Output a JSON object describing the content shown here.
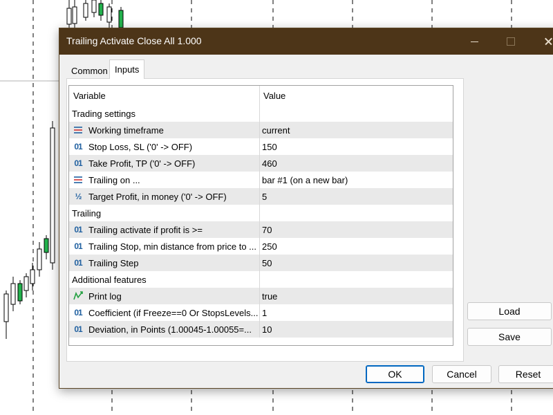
{
  "dialog": {
    "title": "Trailing Activate Close All 1.000"
  },
  "tabs": [
    {
      "label": "Common",
      "active": false
    },
    {
      "label": "Inputs",
      "active": true
    }
  ],
  "grid": {
    "headers": {
      "variable": "Variable",
      "value": "Value"
    },
    "rows": [
      {
        "type": "group",
        "variable": "Trading settings",
        "value": ""
      },
      {
        "type": "param",
        "icon": "enum-icon",
        "variable": "Working timeframe",
        "value": "current"
      },
      {
        "type": "param",
        "icon": "integer-icon",
        "variable": "Stop Loss, SL ('0' -> OFF)",
        "value": "150"
      },
      {
        "type": "param",
        "icon": "integer-icon",
        "variable": "Take Profit, TP ('0' -> OFF)",
        "value": "460"
      },
      {
        "type": "param",
        "icon": "enum-icon",
        "variable": "Trailing on ...",
        "value": "bar #1 (on a new bar)"
      },
      {
        "type": "param",
        "icon": "fraction-icon",
        "variable": "Target Profit, in money ('0' -> OFF)",
        "value": "5"
      },
      {
        "type": "group",
        "variable": "Trailing",
        "value": ""
      },
      {
        "type": "param",
        "icon": "integer-icon",
        "variable": "Trailing activate if profit is >=",
        "value": "70"
      },
      {
        "type": "param",
        "icon": "integer-icon",
        "variable": "Trailing Stop, min distance from price to ...",
        "value": "250"
      },
      {
        "type": "param",
        "icon": "integer-icon",
        "variable": "Trailing Step",
        "value": "50"
      },
      {
        "type": "group",
        "variable": "Additional features",
        "value": ""
      },
      {
        "type": "param",
        "icon": "boolean-icon",
        "variable": "Print log",
        "value": "true"
      },
      {
        "type": "param",
        "icon": "integer-icon",
        "variable": "Coefficient (if Freeze==0 Or StopsLevels...",
        "value": "1"
      },
      {
        "type": "param",
        "icon": "integer-icon",
        "variable": "Deviation, in Points (1.00045-1.00055=...",
        "value": "10"
      }
    ]
  },
  "icon_glyphs": {
    "integer-icon": "01",
    "fraction-icon": "½"
  },
  "buttons": {
    "load": "Load",
    "save": "Save",
    "ok": "OK",
    "cancel": "Cancel",
    "reset": "Reset"
  },
  "colors": {
    "titlebar": "#4d3518",
    "row_shade": "#e9e9e9",
    "icon_blue": "#2060a0",
    "bull_candle": "#22b14c"
  }
}
